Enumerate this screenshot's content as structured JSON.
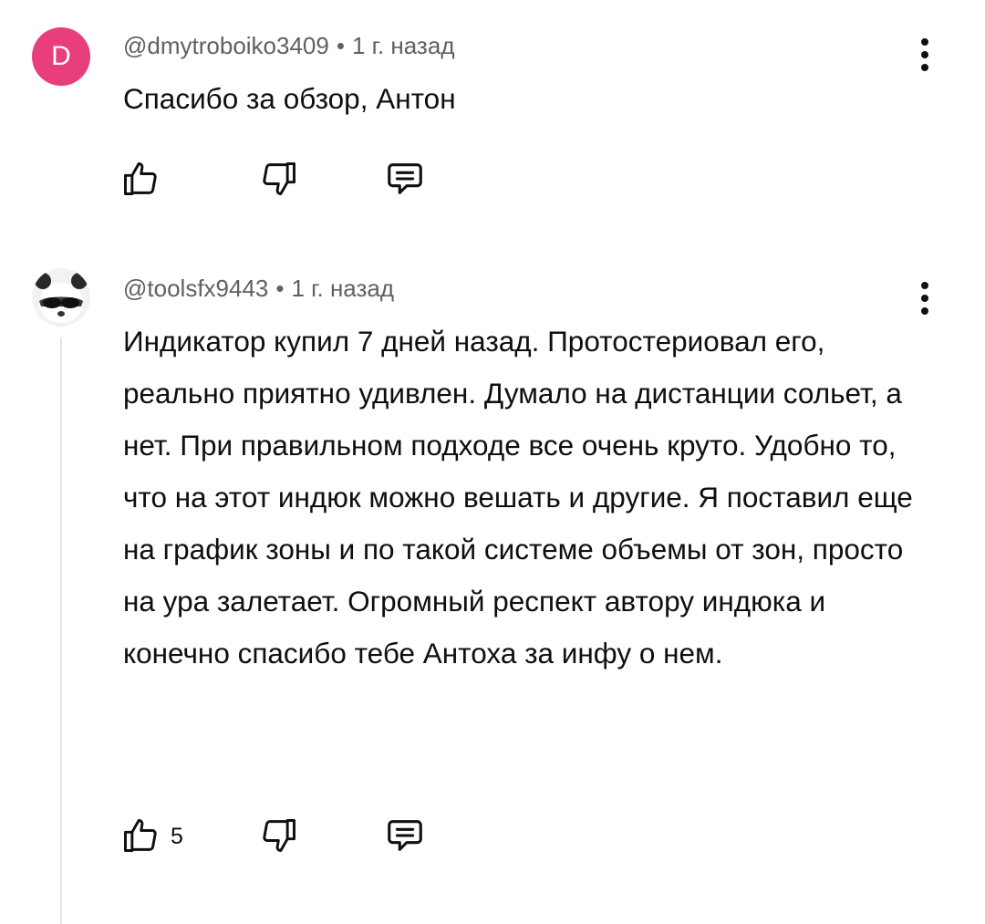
{
  "comments": [
    {
      "avatar_letter": "D",
      "avatar_color": "#e83e7b",
      "author": "@dmytroboiko3409",
      "separator": "•",
      "time": "1 г. назад",
      "text": "Спасибо за обзор, Антон",
      "like_count": "",
      "icons": {
        "like": "thumbs-up-icon",
        "dislike": "thumbs-down-icon",
        "reply": "comment-icon",
        "more": "more-vertical-icon"
      }
    },
    {
      "avatar_letter": "",
      "avatar_description_icon": "panda-with-sunglasses-avatar",
      "author": "@toolsfx9443",
      "separator": "•",
      "time": "1 г. назад",
      "text": "Индикатор купил 7 дней назад. Протостериовал его, реально приятно удивлен. Думало на дистанции сольет, а нет. При правильном подходе все очень круто. Удобно то, что на этот индюк можно вешать и другие. Я поставил еще на график зоны и по такой системе объемы от зон, просто на ура залетает. Огромный респект автору индюка и конечно спасибо тебе Антоха за инфу о нем.",
      "like_count": "5",
      "icons": {
        "like": "thumbs-up-icon",
        "dislike": "thumbs-down-icon",
        "reply": "comment-icon",
        "more": "more-vertical-icon"
      }
    }
  ],
  "colors": {
    "text": "#0f0f0f",
    "meta": "#606060",
    "thread_line": "#e5e5e5",
    "background": "#ffffff"
  }
}
